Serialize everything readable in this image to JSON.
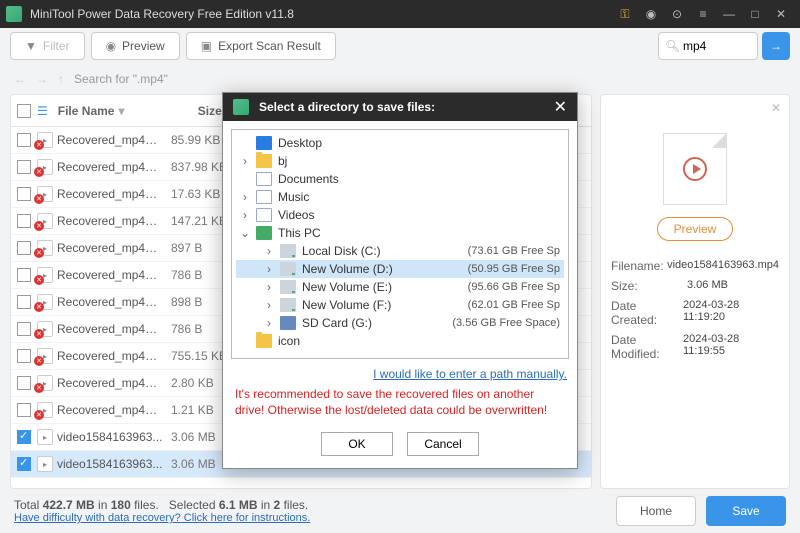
{
  "window": {
    "title": "MiniTool Power Data Recovery Free Edition v11.8"
  },
  "toolbar": {
    "filter": "Filter",
    "preview": "Preview",
    "export": "Export Scan Result"
  },
  "search": {
    "value": "mp4"
  },
  "breadcrumb": {
    "label": "Search for \".mp4\""
  },
  "columns": {
    "name": "File Name",
    "size": "Size"
  },
  "files": [
    {
      "n": "Recovered_mp4_f...",
      "s": "85.99 KB",
      "d": true,
      "c": false
    },
    {
      "n": "Recovered_mp4_f...",
      "s": "837.98 KB",
      "d": true,
      "c": false
    },
    {
      "n": "Recovered_mp4_f...",
      "s": "17.63 KB",
      "d": true,
      "c": false
    },
    {
      "n": "Recovered_mp4_f...",
      "s": "147.21 KB",
      "d": true,
      "c": false
    },
    {
      "n": "Recovered_mp4_f...",
      "s": "897 B",
      "d": true,
      "c": false
    },
    {
      "n": "Recovered_mp4_f...",
      "s": "786 B",
      "d": true,
      "c": false
    },
    {
      "n": "Recovered_mp4_f...",
      "s": "898 B",
      "d": true,
      "c": false
    },
    {
      "n": "Recovered_mp4_f...",
      "s": "786 B",
      "d": true,
      "c": false
    },
    {
      "n": "Recovered_mp4_f...",
      "s": "755.15 KB",
      "d": true,
      "c": false
    },
    {
      "n": "Recovered_mp4_f...",
      "s": "2.80 KB",
      "d": true,
      "c": false
    },
    {
      "n": "Recovered_mp4_f...",
      "s": "1.21 KB",
      "d": true,
      "c": false
    },
    {
      "n": "video1584163963...",
      "s": "3.06 MB",
      "d": false,
      "c": true
    },
    {
      "n": "video1584163963...",
      "s": "3.06 MB",
      "d": false,
      "c": true,
      "sel": true
    }
  ],
  "preview": {
    "btn": "Preview",
    "filename_l": "Filename:",
    "filename_v": "video1584163963.mp4",
    "size_l": "Size:",
    "size_v": "3.06 MB",
    "created_l": "Date Created:",
    "created_v": "2024-03-28 11:19:20",
    "modified_l": "Date Modified:",
    "modified_v": "2024-03-28 11:19:55"
  },
  "footer": {
    "total_a": "Total ",
    "total_b": "422.7 MB",
    "total_c": " in ",
    "total_d": "180",
    "total_e": " files.",
    "sel_a": "Selected ",
    "sel_b": "6.1 MB",
    "sel_c": " in ",
    "sel_d": "2",
    "sel_e": " files.",
    "help": "Have difficulty with data recovery? Click here for instructions.",
    "home": "Home",
    "save": "Save"
  },
  "dialog": {
    "title": "Select a directory to save files:",
    "nodes": [
      {
        "ind": 0,
        "tw": "",
        "ic": "desktop",
        "n": "Desktop",
        "f": ""
      },
      {
        "ind": 0,
        "tw": "›",
        "ic": "folder",
        "n": "bj",
        "f": ""
      },
      {
        "ind": 0,
        "tw": "",
        "ic": "doc",
        "n": "Documents",
        "f": ""
      },
      {
        "ind": 0,
        "tw": "›",
        "ic": "doc",
        "n": "Music",
        "f": ""
      },
      {
        "ind": 0,
        "tw": "›",
        "ic": "doc",
        "n": "Videos",
        "f": ""
      },
      {
        "ind": 0,
        "tw": "⌄",
        "ic": "pc",
        "n": "This PC",
        "f": ""
      },
      {
        "ind": 1,
        "tw": "›",
        "ic": "drive",
        "n": "Local Disk (C:)",
        "f": "(73.61 GB Free Sp"
      },
      {
        "ind": 1,
        "tw": "›",
        "ic": "drive",
        "n": "New Volume (D:)",
        "f": "(50.95 GB Free Sp",
        "sel": true
      },
      {
        "ind": 1,
        "tw": "›",
        "ic": "drive",
        "n": "New Volume (E:)",
        "f": "(95.66 GB Free Sp"
      },
      {
        "ind": 1,
        "tw": "›",
        "ic": "drive",
        "n": "New Volume (F:)",
        "f": "(62.01 GB Free Sp"
      },
      {
        "ind": 1,
        "tw": "›",
        "ic": "sd",
        "n": "SD Card (G:)",
        "f": "(3.56 GB Free Space)"
      },
      {
        "ind": 0,
        "tw": "",
        "ic": "folder",
        "n": "icon",
        "f": ""
      }
    ],
    "manual": "I would like to enter a path manually.",
    "warn": "It's recommended to save the recovered files on another drive! Otherwise the lost/deleted data could be overwritten!",
    "ok": "OK",
    "cancel": "Cancel"
  }
}
